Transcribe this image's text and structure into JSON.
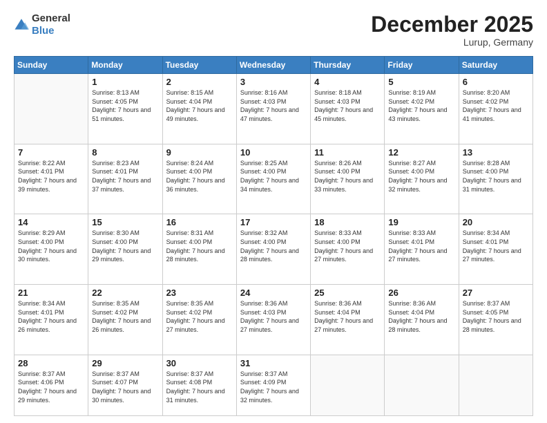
{
  "logo": {
    "text_general": "General",
    "text_blue": "Blue"
  },
  "header": {
    "month_year": "December 2025",
    "location": "Lurup, Germany"
  },
  "weekdays": [
    "Sunday",
    "Monday",
    "Tuesday",
    "Wednesday",
    "Thursday",
    "Friday",
    "Saturday"
  ],
  "weeks": [
    [
      {
        "day": "",
        "empty": true
      },
      {
        "day": "1",
        "sunrise": "8:13 AM",
        "sunset": "4:05 PM",
        "daylight": "7 hours and 51 minutes."
      },
      {
        "day": "2",
        "sunrise": "8:15 AM",
        "sunset": "4:04 PM",
        "daylight": "7 hours and 49 minutes."
      },
      {
        "day": "3",
        "sunrise": "8:16 AM",
        "sunset": "4:03 PM",
        "daylight": "7 hours and 47 minutes."
      },
      {
        "day": "4",
        "sunrise": "8:18 AM",
        "sunset": "4:03 PM",
        "daylight": "7 hours and 45 minutes."
      },
      {
        "day": "5",
        "sunrise": "8:19 AM",
        "sunset": "4:02 PM",
        "daylight": "7 hours and 43 minutes."
      },
      {
        "day": "6",
        "sunrise": "8:20 AM",
        "sunset": "4:02 PM",
        "daylight": "7 hours and 41 minutes."
      }
    ],
    [
      {
        "day": "7",
        "sunrise": "8:22 AM",
        "sunset": "4:01 PM",
        "daylight": "7 hours and 39 minutes."
      },
      {
        "day": "8",
        "sunrise": "8:23 AM",
        "sunset": "4:01 PM",
        "daylight": "7 hours and 37 minutes."
      },
      {
        "day": "9",
        "sunrise": "8:24 AM",
        "sunset": "4:00 PM",
        "daylight": "7 hours and 36 minutes."
      },
      {
        "day": "10",
        "sunrise": "8:25 AM",
        "sunset": "4:00 PM",
        "daylight": "7 hours and 34 minutes."
      },
      {
        "day": "11",
        "sunrise": "8:26 AM",
        "sunset": "4:00 PM",
        "daylight": "7 hours and 33 minutes."
      },
      {
        "day": "12",
        "sunrise": "8:27 AM",
        "sunset": "4:00 PM",
        "daylight": "7 hours and 32 minutes."
      },
      {
        "day": "13",
        "sunrise": "8:28 AM",
        "sunset": "4:00 PM",
        "daylight": "7 hours and 31 minutes."
      }
    ],
    [
      {
        "day": "14",
        "sunrise": "8:29 AM",
        "sunset": "4:00 PM",
        "daylight": "7 hours and 30 minutes."
      },
      {
        "day": "15",
        "sunrise": "8:30 AM",
        "sunset": "4:00 PM",
        "daylight": "7 hours and 29 minutes."
      },
      {
        "day": "16",
        "sunrise": "8:31 AM",
        "sunset": "4:00 PM",
        "daylight": "7 hours and 28 minutes."
      },
      {
        "day": "17",
        "sunrise": "8:32 AM",
        "sunset": "4:00 PM",
        "daylight": "7 hours and 28 minutes."
      },
      {
        "day": "18",
        "sunrise": "8:33 AM",
        "sunset": "4:00 PM",
        "daylight": "7 hours and 27 minutes."
      },
      {
        "day": "19",
        "sunrise": "8:33 AM",
        "sunset": "4:01 PM",
        "daylight": "7 hours and 27 minutes."
      },
      {
        "day": "20",
        "sunrise": "8:34 AM",
        "sunset": "4:01 PM",
        "daylight": "7 hours and 27 minutes."
      }
    ],
    [
      {
        "day": "21",
        "sunrise": "8:34 AM",
        "sunset": "4:01 PM",
        "daylight": "7 hours and 26 minutes."
      },
      {
        "day": "22",
        "sunrise": "8:35 AM",
        "sunset": "4:02 PM",
        "daylight": "7 hours and 26 minutes."
      },
      {
        "day": "23",
        "sunrise": "8:35 AM",
        "sunset": "4:02 PM",
        "daylight": "7 hours and 27 minutes."
      },
      {
        "day": "24",
        "sunrise": "8:36 AM",
        "sunset": "4:03 PM",
        "daylight": "7 hours and 27 minutes."
      },
      {
        "day": "25",
        "sunrise": "8:36 AM",
        "sunset": "4:04 PM",
        "daylight": "7 hours and 27 minutes."
      },
      {
        "day": "26",
        "sunrise": "8:36 AM",
        "sunset": "4:04 PM",
        "daylight": "7 hours and 28 minutes."
      },
      {
        "day": "27",
        "sunrise": "8:37 AM",
        "sunset": "4:05 PM",
        "daylight": "7 hours and 28 minutes."
      }
    ],
    [
      {
        "day": "28",
        "sunrise": "8:37 AM",
        "sunset": "4:06 PM",
        "daylight": "7 hours and 29 minutes."
      },
      {
        "day": "29",
        "sunrise": "8:37 AM",
        "sunset": "4:07 PM",
        "daylight": "7 hours and 30 minutes."
      },
      {
        "day": "30",
        "sunrise": "8:37 AM",
        "sunset": "4:08 PM",
        "daylight": "7 hours and 31 minutes."
      },
      {
        "day": "31",
        "sunrise": "8:37 AM",
        "sunset": "4:09 PM",
        "daylight": "7 hours and 32 minutes."
      },
      {
        "day": "",
        "empty": true
      },
      {
        "day": "",
        "empty": true
      },
      {
        "day": "",
        "empty": true
      }
    ]
  ]
}
